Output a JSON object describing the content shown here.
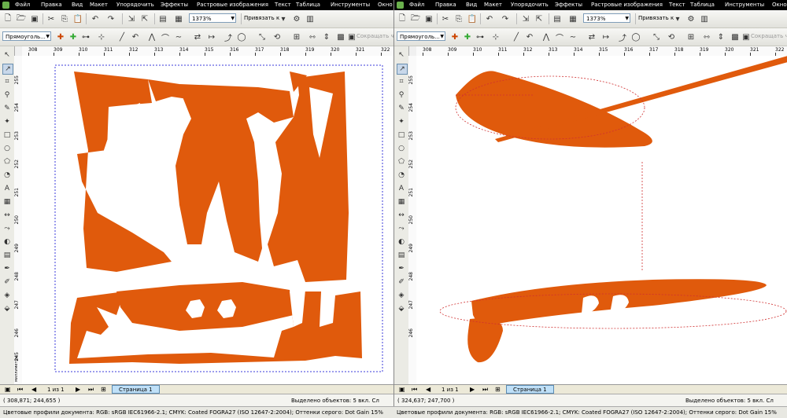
{
  "menu": [
    "Файл",
    "Правка",
    "Вид",
    "Макет",
    "Упорядочить",
    "Эффекты",
    "Растровые изображения",
    "Текст",
    "Таблица",
    "Инструменты",
    "Окно"
  ],
  "toolbar": {
    "zoom": "1373%",
    "snap": "Привязать к",
    "shape_combo": "Прямоуголь...",
    "shorten_label": "Сокращать чк"
  },
  "left": {
    "ruler_h": [
      "308",
      "309",
      "310",
      "311",
      "312",
      "313",
      "314",
      "315",
      "316",
      "317",
      "318",
      "319",
      "320",
      "321",
      "322"
    ],
    "ruler_v": [
      "255",
      "254",
      "253",
      "252",
      "251",
      "250",
      "249",
      "248",
      "247",
      "246",
      "245"
    ],
    "ruler_unit": "миллиметры",
    "page_counter": "1 из 1",
    "page_tab": "Страница 1",
    "status_coords": "( 308,871; 244,655 )",
    "status_selected": "Выделено объектов: 5 вкл. Сл"
  },
  "right": {
    "ruler_h": [
      "308",
      "309",
      "310",
      "311",
      "312",
      "313",
      "314",
      "315",
      "316",
      "317",
      "318",
      "319",
      "320",
      "321",
      "322"
    ],
    "ruler_v": [
      "255",
      "254",
      "253",
      "252",
      "251",
      "250",
      "249",
      "248",
      "247",
      "246"
    ],
    "page_counter": "1 из 1",
    "page_tab": "Страница 1",
    "status_coords": "( 324,637; 247,700 )",
    "status_selected": "Выделено объектов: 5 вкл. Сл"
  },
  "profile_text": "Цветовые профили документа: RGB: sRGB IEC61966-2.1; CMYK: Coated FOGRA27 (ISO 12647-2:2004); Оттенки серого: Dot Gain 15%",
  "colors": {
    "accent": "#e05a0c",
    "selection": "#3b3bdb",
    "tab": "#bfe0f8"
  }
}
